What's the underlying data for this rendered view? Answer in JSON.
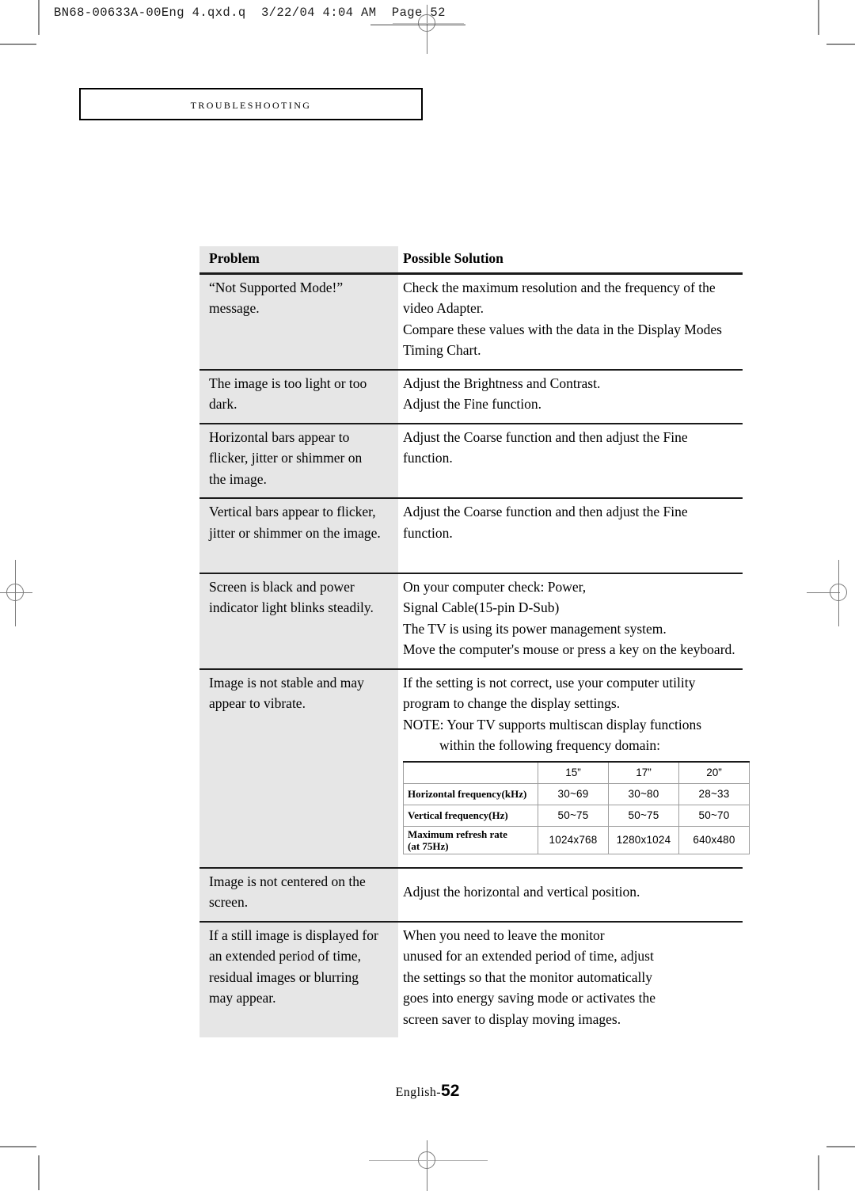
{
  "print_marks": {
    "slug_text": "BN68-00633A-00Eng 4.qxd.q  3/22/04 4:04 AM  Page 52"
  },
  "section": {
    "title": "Troubleshooting"
  },
  "table": {
    "headers": {
      "problem": "Problem",
      "solution": "Possible Solution"
    },
    "rows": [
      {
        "problem": [
          "“Not Supported Mode!”",
          "message."
        ],
        "solution": [
          "Check the maximum resolution and the frequency of the",
          "video Adapter.",
          "Compare these values with the data in the Display Modes",
          "Timing Chart."
        ]
      },
      {
        "problem": [
          "The image is too light or too",
          "dark."
        ],
        "solution": [
          "Adjust the Brightness and Contrast.",
          "Adjust the Fine function."
        ]
      },
      {
        "problem": [
          "Horizontal bars appear to",
          "flicker, jitter or shimmer on",
          "the image."
        ],
        "solution": [
          "Adjust the Coarse function and then adjust the Fine",
          "function."
        ]
      },
      {
        "problem": [
          "Vertical bars appear to flicker,",
          "jitter or shimmer on the image."
        ],
        "solution": [
          "Adjust the Coarse function and then adjust the Fine",
          "function."
        ]
      },
      {
        "problem": [
          "Screen is black and power",
          "indicator light blinks steadily."
        ],
        "solution": [
          "On your computer check: Power,",
          "Signal Cable(15-pin D-Sub)",
          "The TV is using its power management system.",
          "Move the computer's mouse or press a key on the keyboard."
        ]
      },
      {
        "problem": [
          "Image is not stable and may",
          "appear to vibrate."
        ],
        "solution": [
          "If the setting is not correct, use your computer utility",
          "program to change the display settings.",
          "NOTE: Your TV supports multiscan display functions",
          "within the following frequency domain:"
        ]
      },
      {
        "problem": [
          "Image is not centered on the",
          "screen."
        ],
        "solution": [
          "Adjust the horizontal and vertical position."
        ]
      },
      {
        "problem": [
          "If a still image is displayed for",
          "an extended period of time,",
          "residual images or blurring",
          "may appear."
        ],
        "solution": [
          "When you need to leave the monitor",
          "unused for an extended period of time, adjust",
          "the settings so that the monitor automatically",
          "goes into energy saving mode or activates the",
          "screen saver to display moving images."
        ]
      }
    ]
  },
  "frequency_table": {
    "corner": "",
    "columns": [
      "15”",
      "17”",
      "20”"
    ],
    "rows": [
      {
        "label": "Horizontal frequency(kHz)",
        "label_line2": "",
        "values": [
          "30~69",
          "30~80",
          "28~33"
        ]
      },
      {
        "label": "Vertical frequency(Hz)",
        "label_line2": "",
        "values": [
          "50~75",
          "50~75",
          "50~70"
        ]
      },
      {
        "label": "Maximum refresh rate",
        "label_line2": "(at 75Hz)",
        "values": [
          "1024x768",
          "1280x1024",
          "640x480"
        ]
      }
    ]
  },
  "footer": {
    "language": "English-",
    "page_number": "52"
  },
  "colors": {
    "problem_column_bg": "#e6e6e6",
    "rule": "#1a1a1a",
    "mark": "#8a8a8a"
  }
}
